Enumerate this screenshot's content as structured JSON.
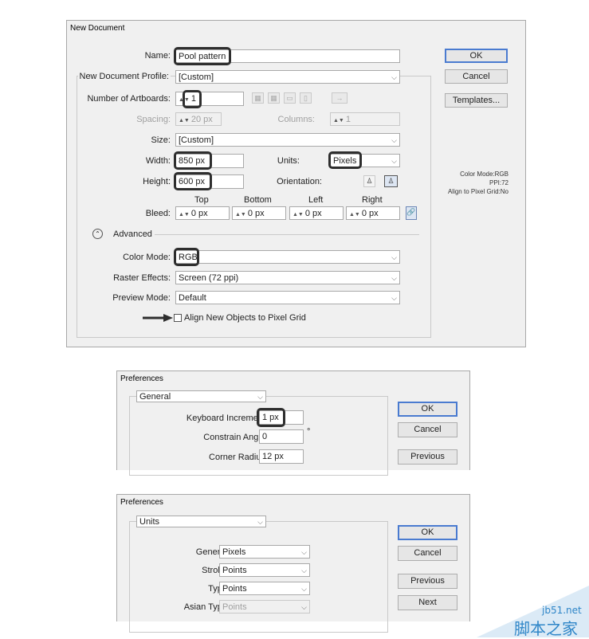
{
  "new_document": {
    "title": "New Document",
    "name_label": "Name:",
    "name_value": "Pool pattern",
    "profile_label": "New Document Profile:",
    "profile_value": "[Custom]",
    "artboards_label": "Number of Artboards:",
    "artboards_value": "1",
    "spacing_label": "Spacing:",
    "spacing_value": "20 px",
    "columns_label": "Columns:",
    "columns_value": "1",
    "size_label": "Size:",
    "size_value": "[Custom]",
    "width_label": "Width:",
    "width_value": "850 px",
    "height_label": "Height:",
    "height_value": "600 px",
    "units_label": "Units:",
    "units_value": "Pixels",
    "orientation_label": "Orientation:",
    "bleed_label": "Bleed:",
    "bleed_top_label": "Top",
    "bleed_bottom_label": "Bottom",
    "bleed_left_label": "Left",
    "bleed_right_label": "Right",
    "bleed_top": "0 px",
    "bleed_bottom": "0 px",
    "bleed_left": "0 px",
    "bleed_right": "0 px",
    "advanced_label": "Advanced",
    "color_mode_label": "Color Mode:",
    "color_mode_value": "RGB",
    "raster_label": "Raster Effects:",
    "raster_value": "Screen (72 ppi)",
    "preview_label": "Preview Mode:",
    "preview_value": "Default",
    "align_label": "Align New Objects to Pixel Grid",
    "ok": "OK",
    "cancel": "Cancel",
    "templates": "Templates...",
    "info_color_mode": "Color Mode:RGB",
    "info_ppi": "PPI:72",
    "info_align": "Align to Pixel Grid:No"
  },
  "prefs_general": {
    "title": "Preferences",
    "section": "General",
    "keyboard_label": "Keyboard Increment:",
    "keyboard_value": "1 px",
    "constrain_label": "Constrain Angle:",
    "constrain_value": "0",
    "degree": "°",
    "corner_label": "Corner Radius:",
    "corner_value": "12 px",
    "ok": "OK",
    "cancel": "Cancel",
    "previous": "Previous"
  },
  "prefs_units": {
    "title": "Preferences",
    "section": "Units",
    "general_label": "General:",
    "general_value": "Pixels",
    "stroke_label": "Stroke:",
    "stroke_value": "Points",
    "type_label": "Type:",
    "type_value": "Points",
    "asian_label": "Asian Type:",
    "asian_value": "Points",
    "ok": "OK",
    "cancel": "Cancel",
    "previous": "Previous",
    "next": "Next"
  },
  "watermark": {
    "site": "jb51.net",
    "cn": "脚本之家"
  },
  "colors": {
    "accent": "#4a7bd0",
    "highlight": "#2e2e2e",
    "watermark": "#2f86c8"
  }
}
